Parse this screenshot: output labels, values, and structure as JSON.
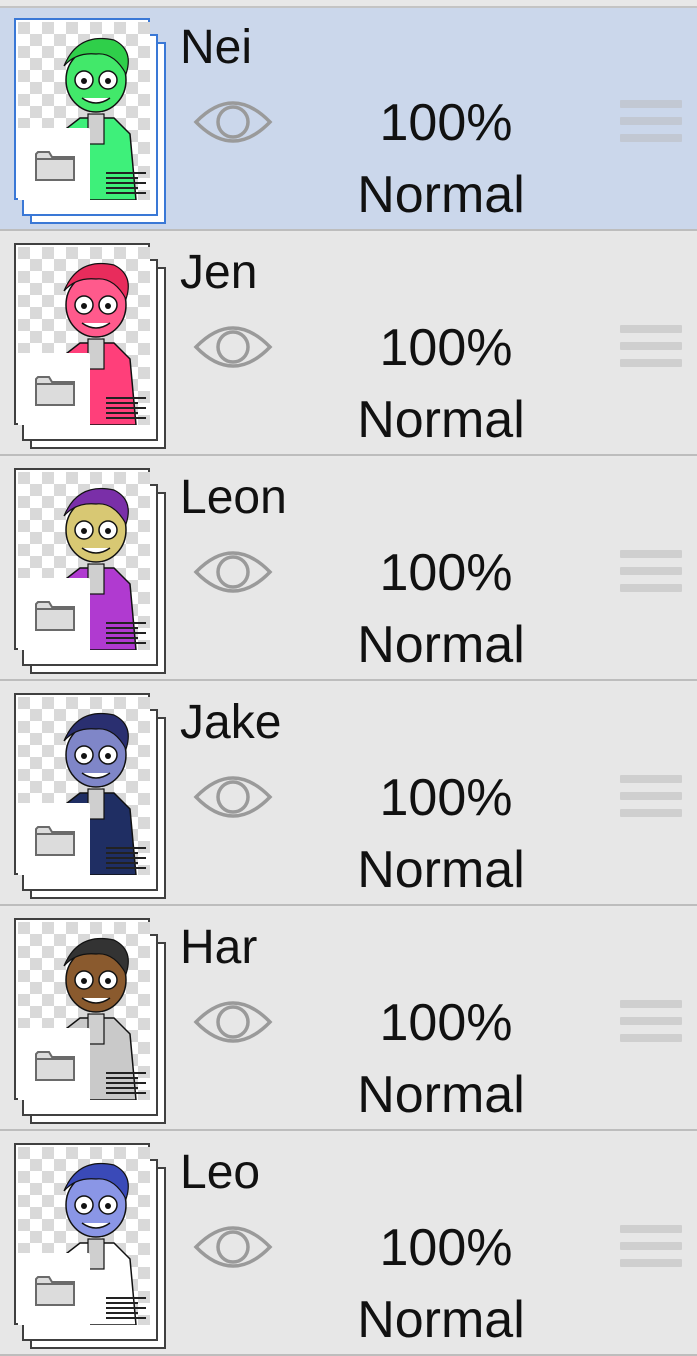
{
  "layers_panel": {
    "layers": [
      {
        "name": "Nei",
        "opacity": "100%",
        "blend": "Normal",
        "visible": true,
        "selected": true,
        "accent": "#3ef07a",
        "skin": "#42e86a",
        "hair": "#2fcf4a",
        "type_icon": "folder-icon"
      },
      {
        "name": "Jen",
        "opacity": "100%",
        "blend": "Normal",
        "visible": true,
        "selected": false,
        "accent": "#ff3f7a",
        "skin": "#ff5a8c",
        "hair": "#e82c5c",
        "type_icon": "folder-icon"
      },
      {
        "name": "Leon",
        "opacity": "100%",
        "blend": "Normal",
        "visible": true,
        "selected": false,
        "accent": "#b03ad0",
        "skin": "#d8c873",
        "hair": "#7a2fa8",
        "type_icon": "folder-icon"
      },
      {
        "name": "Jake",
        "opacity": "100%",
        "blend": "Normal",
        "visible": true,
        "selected": false,
        "accent": "#1f2e63",
        "skin": "#7f86c8",
        "hair": "#2a2f70",
        "type_icon": "folder-icon"
      },
      {
        "name": "Har",
        "opacity": "100%",
        "blend": "Normal",
        "visible": true,
        "selected": false,
        "accent": "#c9c9c9",
        "skin": "#8a5a2e",
        "hair": "#333333",
        "type_icon": "folder-icon"
      },
      {
        "name": "Leo",
        "opacity": "100%",
        "blend": "Normal",
        "visible": true,
        "selected": false,
        "accent": "#ffffff",
        "skin": "#8a96e6",
        "hair": "#3a4ab8",
        "type_icon": "folder-icon"
      }
    ]
  },
  "colors": {
    "selected_row": "#cbd7eb",
    "row": "#e7e7e7",
    "selection_border": "#3a78d6",
    "eye_stroke": "#9a9a9a"
  }
}
